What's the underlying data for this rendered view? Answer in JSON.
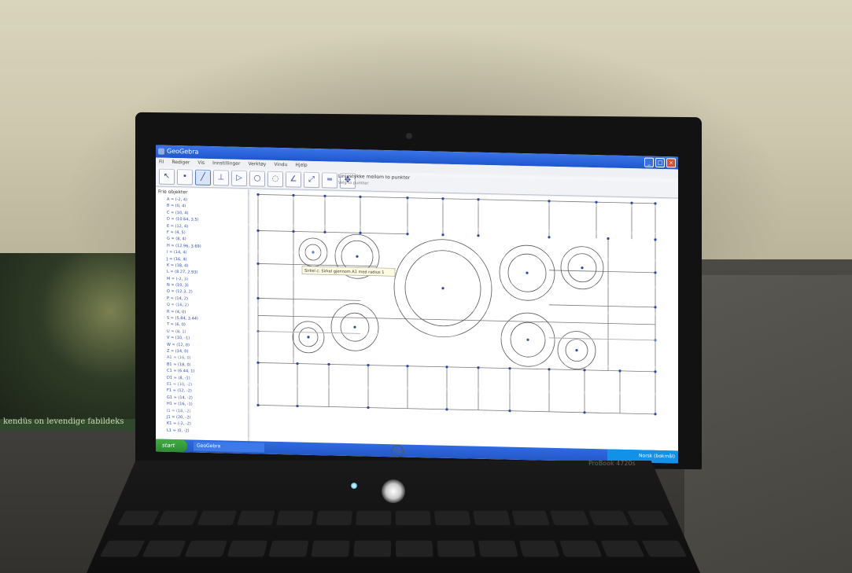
{
  "scene": {
    "description_free": true,
    "book_spine_text": "kendüs on levendige fabildeks"
  },
  "laptop": {
    "brand_mark": "hp",
    "model_text": "ProBook 4720s"
  },
  "app": {
    "title": "GeoGebra",
    "menu": [
      "Fil",
      "Rediger",
      "Vis",
      "Innstillinger",
      "Verktøy",
      "Vindu",
      "Hjelp"
    ],
    "tool_help_title": "Linjestykke mellom to punkter",
    "tool_help_sub": "Velg to punkter",
    "algebra_header": "Frie objekter",
    "algebra_rows": [
      "A = (-2, 4)",
      "B = (0, 4)",
      "C = (10, 4)",
      "D = (10.64, 3.5)",
      "E = (12, 4)",
      "F = (4, 5)",
      "G = (8, 4)",
      "H = (12.96, 3.69)",
      "I = (14, 4)",
      "J = (16, 4)",
      "K = (18, 4)",
      "L = (8.27, 2.93)",
      "M = (-2, 3)",
      "N = (10, 3)",
      "O = (12.3, 2)",
      "P = (14, 2)",
      "Q = (16, 2)",
      "R = (4, 0)",
      "S = (5.84, 3.44)",
      "T = (6, 0)",
      "U = (8, 1)",
      "V = (10, -1)",
      "W = (12, 0)",
      "Z = (14, 0)",
      "A1 = (16, 0)",
      "B1 = (18, 0)",
      "C1 = (6.44, 1)",
      "D1 = (8, -1)",
      "E1 = (10, -2)",
      "F1 = (12, -2)",
      "G1 = (14, -2)",
      "H1 = (16, -1)",
      "I1 = (18, -2)",
      "J1 = (20, -2)",
      "K1 = (-2, -2)",
      "L1 = (0, -2)"
    ],
    "graphics_tooltip": "Sirkel c: Sirkel gjennom A1 med radius 1",
    "taskbar": {
      "start_label": "start",
      "window_label": "GeoGebra",
      "clock": "Norsk (bokmål)"
    }
  }
}
